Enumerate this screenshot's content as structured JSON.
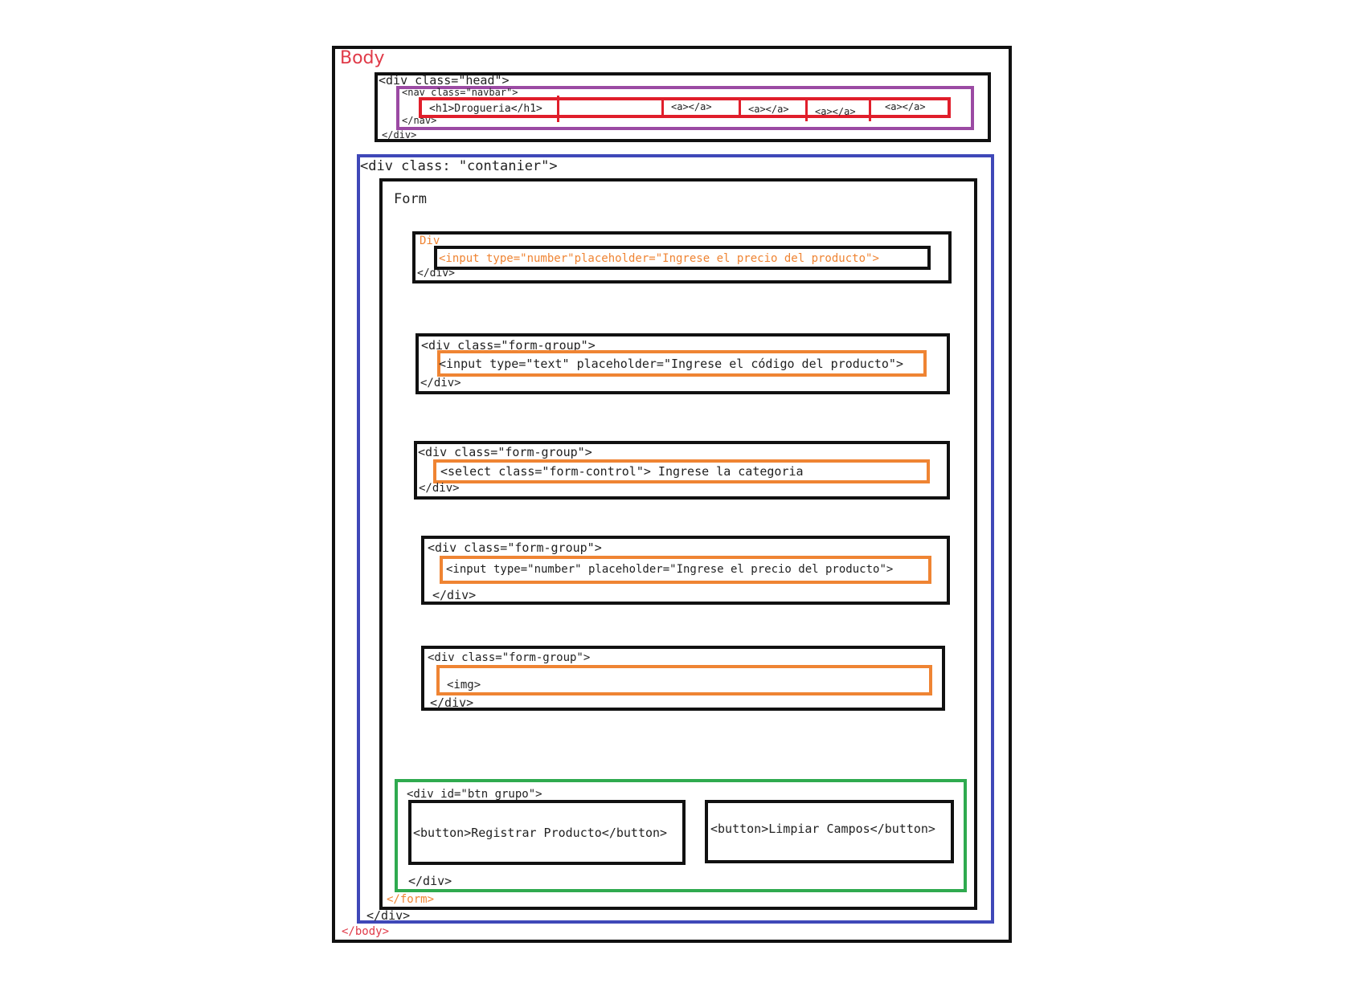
{
  "diagram": {
    "body_open": "Body",
    "body_close": "</body>",
    "head": {
      "open": "<div class=\"head\">",
      "close": "</div>",
      "nav_open": "<nav class=\"navbar\">",
      "nav_close": "</nav>",
      "h1": "<h1>Drogueria</h1>",
      "links": [
        "<a></a>",
        "<a></a>",
        "<a></a>",
        "<a></a>"
      ]
    },
    "container": {
      "open": "<div class: \"contanier\">",
      "close": "</div>"
    },
    "form": {
      "open": "Form",
      "close": "</form>"
    },
    "groups": [
      {
        "open": "Div",
        "field": "<input type=\"number\"placeholder=\"Ingrese el precio del producto\">",
        "close": "</div>"
      },
      {
        "open": "<div class=\"form-group\">",
        "field": "<input type=\"text\" placeholder=\"Ingrese el código del producto\">",
        "close": "</div>"
      },
      {
        "open": "<div class=\"form-group\">",
        "field": "<select class=\"form-control\"> Ingrese la categoria",
        "close": "</div>"
      },
      {
        "open": "<div class=\"form-group\">",
        "field": "<input type=\"number\" placeholder=\"Ingrese el precio del producto\">",
        "close": "</div>"
      },
      {
        "open": "<div class=\"form-group\">",
        "field": "<img>",
        "close": "</div>"
      }
    ],
    "btn_group": {
      "open": "<div id=\"btn_grupo\">",
      "close": "</div>",
      "buttons": [
        "<button>Registrar Producto</button>",
        "<button>Limpiar Campos</button>"
      ]
    },
    "colors": {
      "body": "#111111",
      "head_label": "#e03a48",
      "container": "#3f48b8",
      "navbar": "#9b4aa3",
      "nav_items": "#e01e2b",
      "fields": "#ef8433",
      "btn_group": "#2faa4f"
    }
  }
}
